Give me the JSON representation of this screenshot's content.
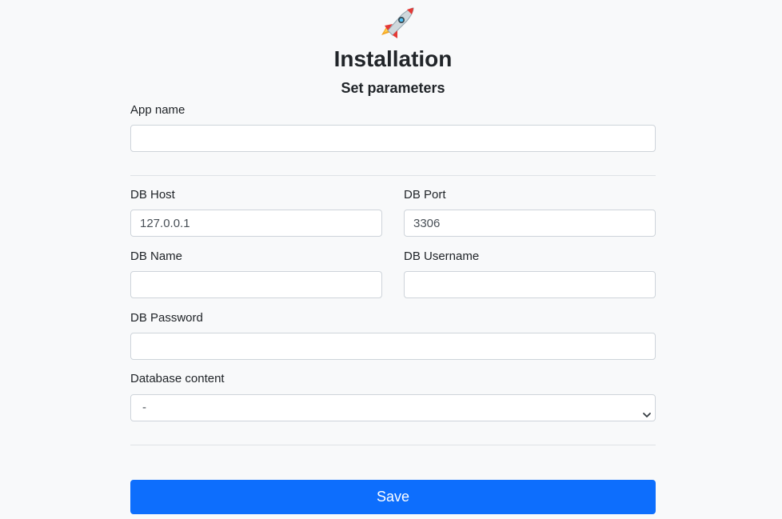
{
  "header": {
    "logo_icon": "rocket-icon",
    "title": "Installation",
    "subtitle": "Set parameters"
  },
  "form": {
    "app_name": {
      "label": "App name",
      "value": ""
    },
    "db_host": {
      "label": "DB Host",
      "value": "127.0.0.1"
    },
    "db_port": {
      "label": "DB Port",
      "value": "3306"
    },
    "db_name": {
      "label": "DB Name",
      "value": ""
    },
    "db_username": {
      "label": "DB Username",
      "value": ""
    },
    "db_password": {
      "label": "DB Password",
      "value": ""
    },
    "database_content": {
      "label": "Database content",
      "selected": "-"
    },
    "save_label": "Save"
  },
  "colors": {
    "background": "#f8f9fa",
    "primary": "#0d6efd",
    "border": "#ced4da"
  }
}
